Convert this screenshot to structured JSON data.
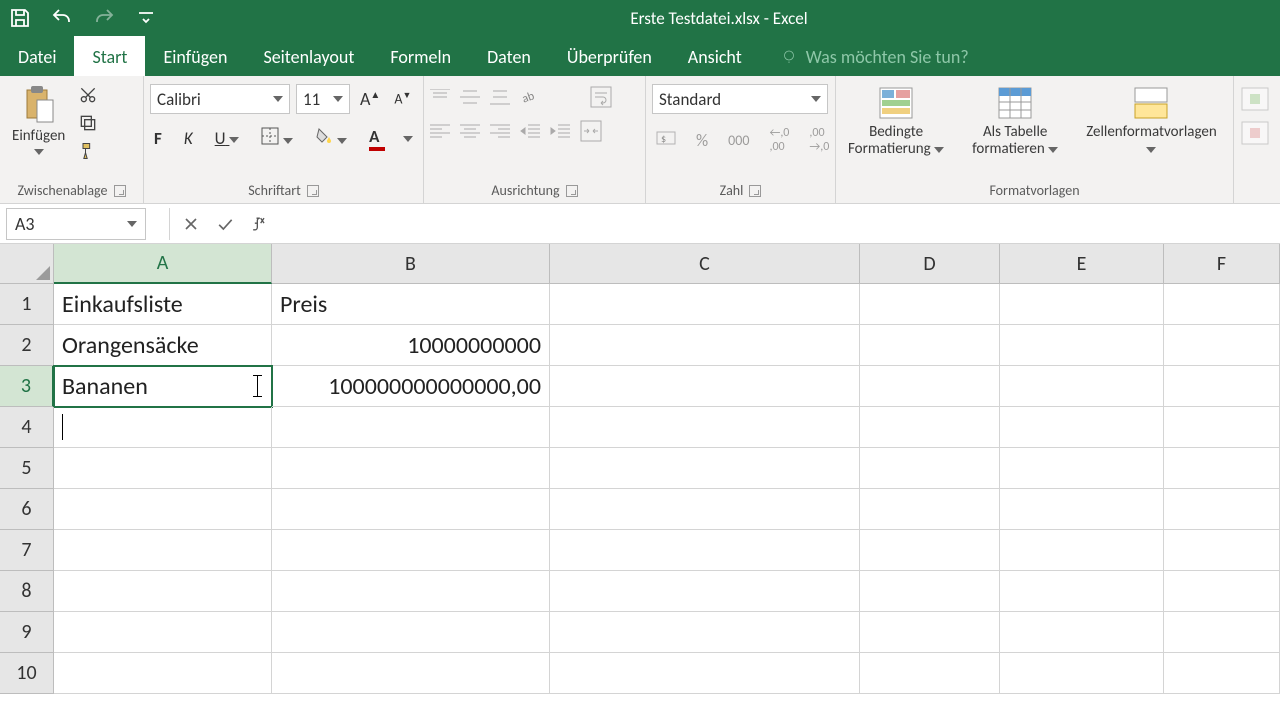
{
  "app": {
    "title": "Erste Testdatei.xlsx - Excel"
  },
  "tabs": {
    "items": [
      "Datei",
      "Start",
      "Einfügen",
      "Seitenlayout",
      "Formeln",
      "Daten",
      "Überprüfen",
      "Ansicht"
    ],
    "active": "Start",
    "tellme": "Was möchten Sie tun?"
  },
  "ribbon": {
    "clipboard": {
      "paste": "Einfügen",
      "group": "Zwischenablage"
    },
    "font": {
      "name": "Calibri",
      "size": "11",
      "bold": "F",
      "italic": "K",
      "underline": "U",
      "group": "Schriftart"
    },
    "alignment": {
      "group": "Ausrichtung"
    },
    "number": {
      "format": "Standard",
      "group": "Zahl"
    },
    "styles": {
      "cond": "Bedingte Formatierung",
      "cond1": "Bedingte",
      "cond2": "Formatierung",
      "table": "Als Tabelle formatieren",
      "table1": "Als Tabelle",
      "table2": "formatieren",
      "cellstyles": "Zellenformatvorlagen",
      "group": "Formatvorlagen"
    }
  },
  "namebox": "A3",
  "formula": "",
  "columns": [
    "A",
    "B",
    "C",
    "D",
    "E",
    "F"
  ],
  "rows": [
    "1",
    "2",
    "3",
    "4",
    "5",
    "6",
    "7",
    "8",
    "9",
    "10"
  ],
  "cells": {
    "A1": "Einkaufsliste",
    "B1": "Preis",
    "A2": "Orangensäcke",
    "B2": "10000000000",
    "A3": "Bananen",
    "B3": "100000000000000,00"
  },
  "colors": {
    "brand": "#217346",
    "accent": "#c00000"
  }
}
